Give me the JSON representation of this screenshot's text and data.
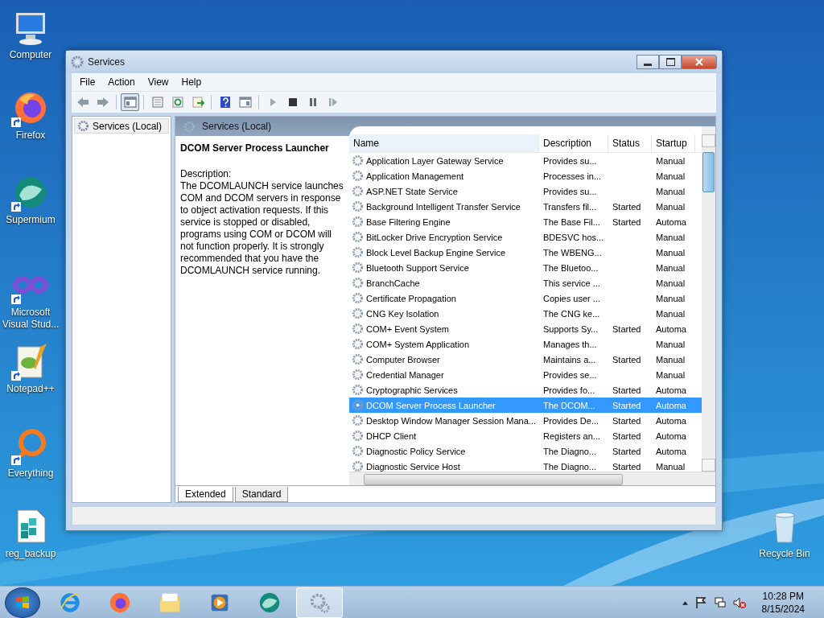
{
  "desktop_icons": [
    {
      "label": "Computer",
      "kind": "computer",
      "shortcut": false
    },
    {
      "label": "Firefox",
      "kind": "firefox",
      "shortcut": true
    },
    {
      "label": "Supermium",
      "kind": "supermium",
      "shortcut": true
    },
    {
      "label": "Microsoft Visual Stud...",
      "kind": "visualstudio",
      "shortcut": true
    },
    {
      "label": "Notepad++",
      "kind": "notepad",
      "shortcut": true
    },
    {
      "label": "Everything",
      "kind": "everything",
      "shortcut": true
    },
    {
      "label": "reg_backup",
      "kind": "regfile",
      "shortcut": false
    },
    {
      "label": "Recycle Bin",
      "kind": "recycle",
      "shortcut": false
    }
  ],
  "window": {
    "title": "Services",
    "menu": [
      "File",
      "Action",
      "View",
      "Help"
    ],
    "toolbar": [
      {
        "kind": "back"
      },
      {
        "kind": "forward"
      },
      {
        "kind": "sep"
      },
      {
        "kind": "tree",
        "pressed": true
      },
      {
        "kind": "sep"
      },
      {
        "kind": "properties"
      },
      {
        "kind": "refresh"
      },
      {
        "kind": "export"
      },
      {
        "kind": "sep"
      },
      {
        "kind": "help"
      },
      {
        "kind": "console"
      },
      {
        "kind": "sep"
      },
      {
        "kind": "play"
      },
      {
        "kind": "stop"
      },
      {
        "kind": "pause"
      },
      {
        "kind": "resume"
      }
    ],
    "tree": [
      {
        "label": "Services (Local)",
        "selected": true
      }
    ],
    "panel_title": "Services (Local)",
    "detail": {
      "title": "DCOM Server Process Launcher",
      "label": "Description:",
      "text": "The DCOMLAUNCH service launches COM and DCOM servers in response to object activation requests. If this service is stopped or disabled, programs using COM or DCOM will not function properly. It is strongly recommended that you have the DCOMLAUNCH service running."
    },
    "table": {
      "columns": [
        "Name",
        "Description",
        "Status",
        "Startup"
      ],
      "rows": [
        {
          "name": "Application Layer Gateway Service",
          "description": "Provides su...",
          "startup": "Manual",
          "selected": false
        },
        {
          "name": "Application Management",
          "description": "Processes in...",
          "startup": "Manual",
          "selected": false
        },
        {
          "name": "ASP.NET State Service",
          "description": "Provides su...",
          "startup": "Manual",
          "selected": false
        },
        {
          "name": "Background Intelligent Transfer Service",
          "description": "Transfers fil...",
          "status": "Started",
          "startup": "Manual",
          "selected": false
        },
        {
          "name": "Base Filtering Engine",
          "description": "The Base Fil...",
          "status": "Started",
          "startup": "Automa",
          "selected": false
        },
        {
          "name": "BitLocker Drive Encryption Service",
          "description": "BDESVC hos...",
          "startup": "Manual",
          "selected": false
        },
        {
          "name": "Block Level Backup Engine Service",
          "description": "The WBENG...",
          "startup": "Manual",
          "selected": false
        },
        {
          "name": "Bluetooth Support Service",
          "description": "The Bluetoo...",
          "startup": "Manual",
          "selected": false
        },
        {
          "name": "BranchCache",
          "description": "This service ...",
          "startup": "Manual",
          "selected": false
        },
        {
          "name": "Certificate Propagation",
          "description": "Copies user ...",
          "startup": "Manual",
          "selected": false
        },
        {
          "name": "CNG Key Isolation",
          "description": "The CNG ke...",
          "startup": "Manual",
          "selected": false
        },
        {
          "name": "COM+ Event System",
          "description": "Supports Sy...",
          "status": "Started",
          "startup": "Automa",
          "selected": false
        },
        {
          "name": "COM+ System Application",
          "description": "Manages th...",
          "startup": "Manual",
          "selected": false
        },
        {
          "name": "Computer Browser",
          "description": "Maintains a...",
          "status": "Started",
          "startup": "Manual",
          "selected": false
        },
        {
          "name": "Credential Manager",
          "description": "Provides se...",
          "startup": "Manual",
          "selected": false
        },
        {
          "name": "Cryptographic Services",
          "description": "Provides fo...",
          "status": "Started",
          "startup": "Automa",
          "selected": false
        },
        {
          "name": "DCOM Server Process Launcher",
          "description": "The DCOM...",
          "status": "Started",
          "startup": "Automa",
          "selected": true
        },
        {
          "name": "Desktop Window Manager Session Mana...",
          "description": "Provides De...",
          "status": "Started",
          "startup": "Automa",
          "selected": false
        },
        {
          "name": "DHCP Client",
          "description": "Registers an...",
          "status": "Started",
          "startup": "Automa",
          "selected": false
        },
        {
          "name": "Diagnostic Policy Service",
          "description": "The Diagno...",
          "status": "Started",
          "startup": "Automa",
          "selected": false
        },
        {
          "name": "Diagnostic Service Host",
          "description": "The Diagno...",
          "status": "Started",
          "startup": "Manual",
          "selected": false
        }
      ]
    },
    "tabs": [
      {
        "label": "Extended",
        "selected": true
      },
      {
        "label": "Standard",
        "selected": false
      }
    ]
  },
  "taskbar": {
    "items": [
      {
        "kind": "ie",
        "active": false
      },
      {
        "kind": "firefox",
        "active": false
      },
      {
        "kind": "explorer",
        "active": false
      },
      {
        "kind": "media",
        "active": false
      },
      {
        "kind": "supermium",
        "active": false
      },
      {
        "kind": "services",
        "active": true
      }
    ],
    "time": "10:28 PM",
    "date": "8/15/2024"
  }
}
